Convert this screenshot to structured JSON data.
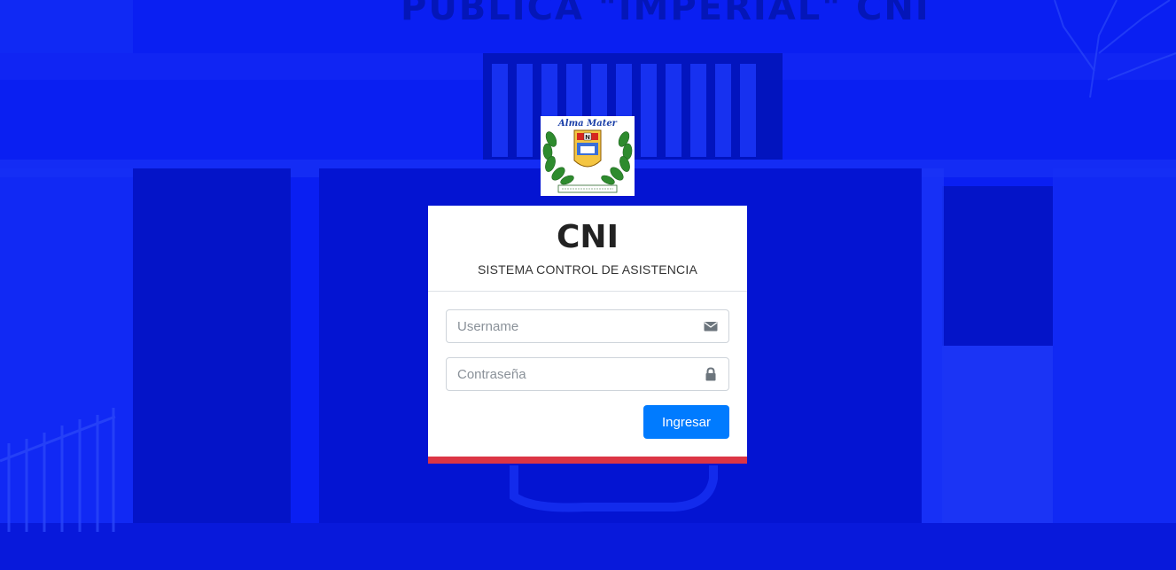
{
  "background": {
    "sign_text": "PUBLICA \"IMPERIAL\" CNI",
    "color": "#0a1ff2"
  },
  "logo": {
    "icon": "school-crest-icon",
    "motto": "Alma Mater",
    "shield_letter": "N"
  },
  "card": {
    "brand": "CNI",
    "subtitle": "SISTEMA CONTROL DE ASISTENCIA"
  },
  "form": {
    "username": {
      "value": "",
      "placeholder": "Username",
      "icon": "envelope-icon"
    },
    "password": {
      "value": "",
      "placeholder": "Contraseña",
      "icon": "lock-icon"
    },
    "submit_label": "Ingresar"
  },
  "colors": {
    "primary": "#007bff",
    "accent_bar": "#dc3545",
    "background": "#0a1ff2"
  }
}
